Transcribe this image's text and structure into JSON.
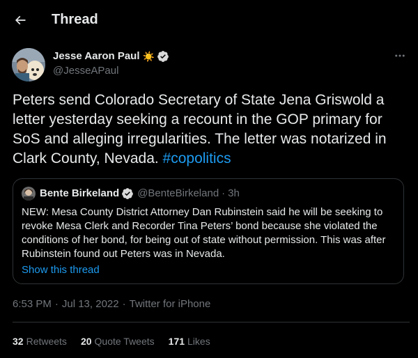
{
  "header": {
    "title": "Thread",
    "back_icon": "arrow-left-icon"
  },
  "author": {
    "name": "Jesse Aaron Paul",
    "emoji": "☀️",
    "verified": true,
    "handle": "@JesseAPaul",
    "more_icon": "more-horizontal-icon"
  },
  "tweet": {
    "text": "Peters send Colorado Secretary of State Jena Griswold a letter yesterday seeking a recount in the GOP primary for SoS and alleging irregularities. The letter was notarized in Clark County, Nevada.",
    "hashtag": "#copolitics"
  },
  "quote": {
    "name": "Bente Birkeland",
    "verified": true,
    "handle": "@BenteBirkeland",
    "separator": "·",
    "time": "3h",
    "text": "NEW: Mesa County District Attorney Dan Rubinstein said he will be seeking to revoke Mesa Clerk and Recorder Tina Peters’ bond because she violated the conditions of her bond, for being out of state without permission. This was after Rubinstein found out Peters was in Nevada.",
    "show_thread": "Show this thread"
  },
  "meta": {
    "time": "6:53 PM",
    "separator": "·",
    "date": "Jul 13, 2022",
    "source": "Twitter for iPhone"
  },
  "stats": {
    "retweets_count": "32",
    "retweets_label": "Retweets",
    "quotes_count": "20",
    "quotes_label": "Quote Tweets",
    "likes_count": "171",
    "likes_label": "Likes"
  },
  "colors": {
    "background": "#000000",
    "text": "#e7e9ea",
    "secondary": "#71767b",
    "accent": "#1d9bf0",
    "border": "#2f3336"
  }
}
